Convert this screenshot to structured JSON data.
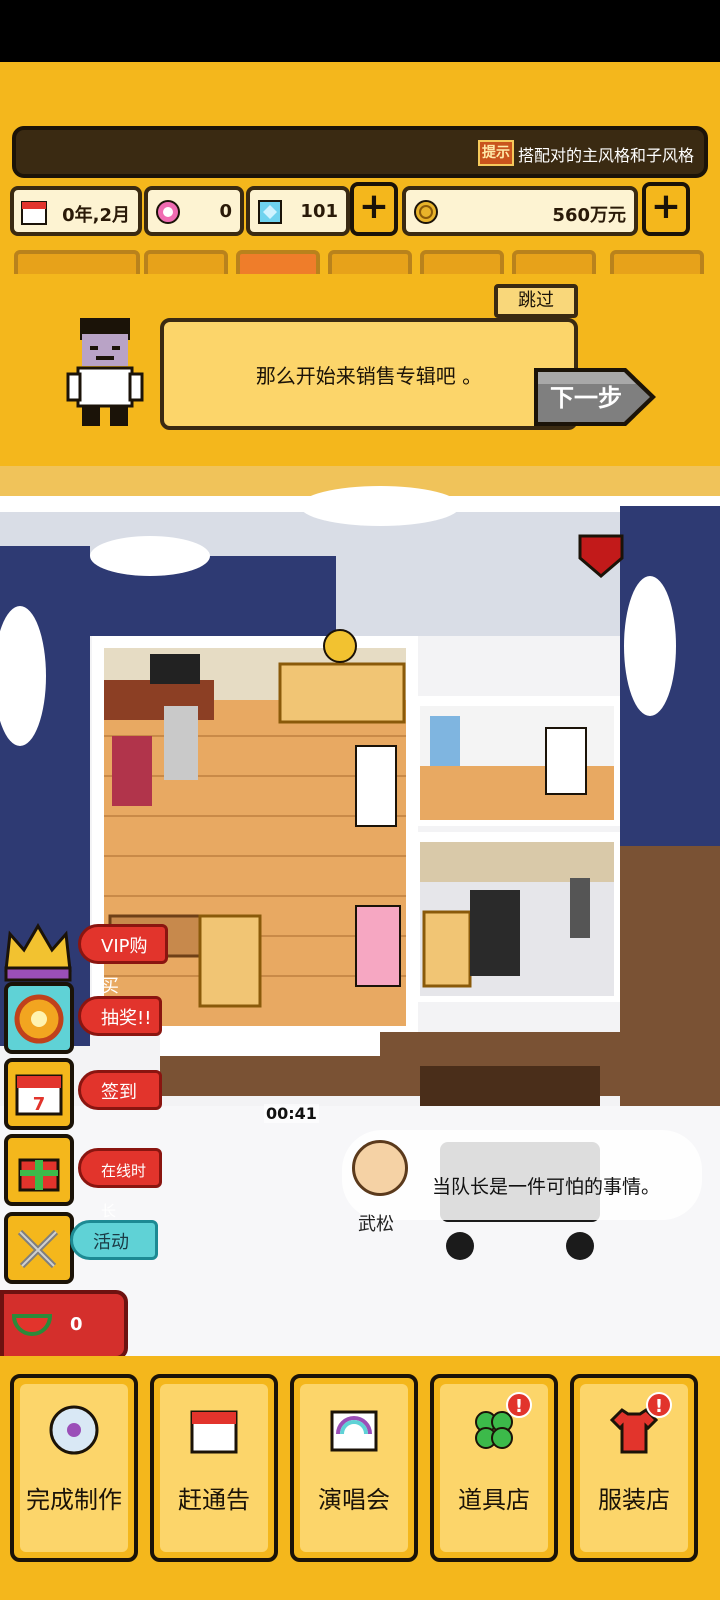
{
  "ticker": {
    "tip_badge": "提示",
    "tip_text": "搭配对的主风格和子风格"
  },
  "resources": {
    "date": "0年,2月",
    "gems": "0",
    "diamonds": "101",
    "money": "560万元",
    "plus": "+"
  },
  "tutorial": {
    "skip_label": "跳过",
    "message": "那么开始来销售专辑吧 。",
    "next_label": "下一步"
  },
  "side_menu": {
    "vip_label": "VIP购买",
    "lottery_label": "抽奖!!",
    "checkin_label": "签到",
    "online_label": "在线时长",
    "event_label": "活动",
    "melon_count": "0"
  },
  "scene": {
    "countdown": "00:41",
    "chat_name": "武松",
    "chat_text": "当队长是一件可怕的事情。"
  },
  "bottom_nav": [
    {
      "label": "完成制作",
      "icon": "disc-icon",
      "badge": ""
    },
    {
      "label": "赶通告",
      "icon": "calendar-icon",
      "badge": ""
    },
    {
      "label": "演唱会",
      "icon": "concert-icon",
      "badge": ""
    },
    {
      "label": "道具店",
      "icon": "clover-icon",
      "badge": "!"
    },
    {
      "label": "服装店",
      "icon": "shirt-icon",
      "badge": "!"
    }
  ],
  "colors": {
    "primary_yellow": "#f4b71c",
    "dark_outline": "#1b1308",
    "alert_red": "#e2342c",
    "cyan_tag": "#5fd2d6"
  }
}
